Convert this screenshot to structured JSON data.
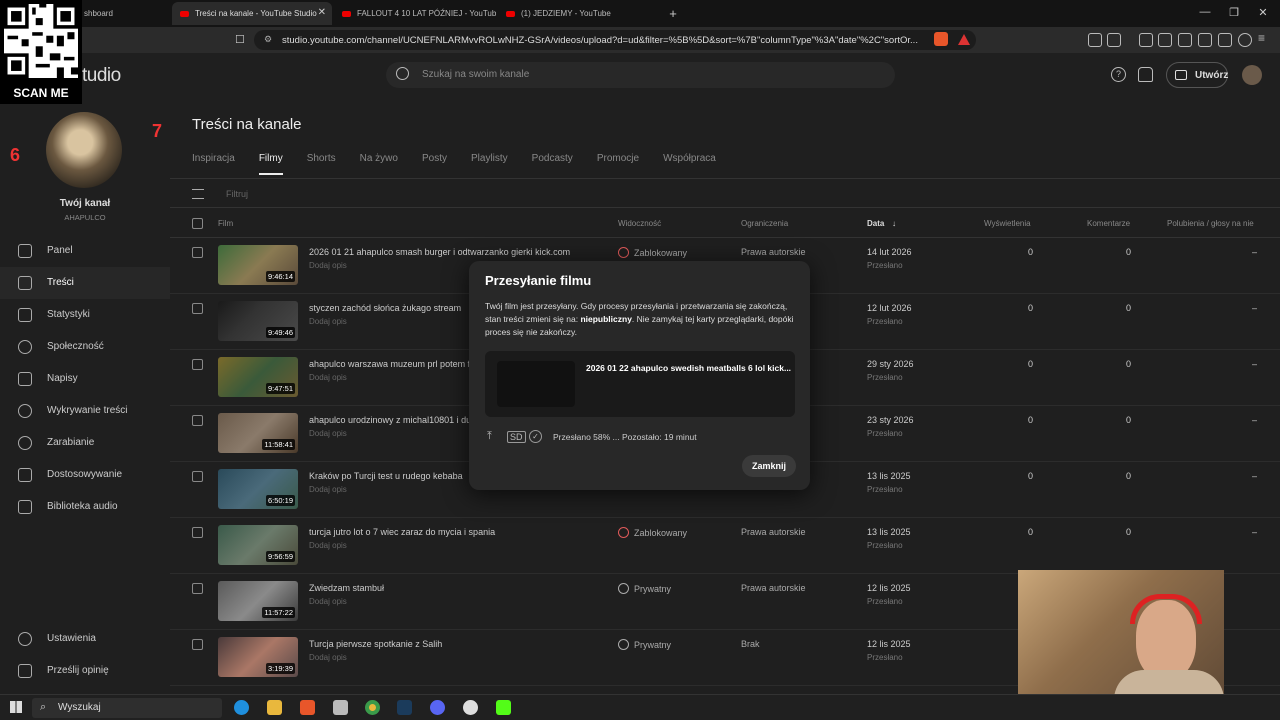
{
  "browser": {
    "tabs": [
      {
        "label": "shboard"
      },
      {
        "label": "Treści na kanale - YouTube Studio"
      },
      {
        "label": "FALLOUT 4 10 LAT PÓŹNIEJ - YouTube"
      },
      {
        "label": "(1) JEDZIEMY - YouTube"
      }
    ],
    "url": "studio.youtube.com/channel/UCNEFNLARMvvROLwNHZ-GSrA/videos/upload?d=ud&filter=%5B%5D&sort=%7B\"columnType\"%3A\"date\"%2C\"sortOr..."
  },
  "studio": {
    "logo_text": "tudio",
    "search_placeholder": "Szukaj na swoim kanale",
    "create_label": "Utwórz"
  },
  "sidebar": {
    "channel_name": "Twój kanał",
    "channel_handle": "AHAPULCO",
    "items": [
      {
        "label": "Panel"
      },
      {
        "label": "Treści"
      },
      {
        "label": "Statystyki"
      },
      {
        "label": "Społeczność"
      },
      {
        "label": "Napisy"
      },
      {
        "label": "Wykrywanie treści"
      },
      {
        "label": "Zarabianie"
      },
      {
        "label": "Dostosowywanie"
      },
      {
        "label": "Biblioteka audio"
      }
    ],
    "bottom_items": [
      {
        "label": "Ustawienia"
      },
      {
        "label": "Prześlij opinię"
      }
    ]
  },
  "main": {
    "title": "Treści na kanale",
    "tabs": [
      {
        "label": "Inspiracja"
      },
      {
        "label": "Filmy"
      },
      {
        "label": "Shorts"
      },
      {
        "label": "Na żywo"
      },
      {
        "label": "Posty"
      },
      {
        "label": "Playlisty"
      },
      {
        "label": "Podcasty"
      },
      {
        "label": "Promocje"
      },
      {
        "label": "Współpraca"
      }
    ],
    "filter_placeholder": "Filtruj",
    "columns": {
      "film": "Film",
      "visibility": "Widoczność",
      "restrictions": "Ograniczenia",
      "date": "Data",
      "views": "Wyświetlenia",
      "comments": "Komentarze",
      "likes": "Polubienia / głosy na nie"
    },
    "rows": [
      {
        "title": "2026 01 21 ahapulco smash burger i odtwarzanko gierki kick.com",
        "desc": "Dodaj opis",
        "duration": "9:46:14",
        "visibility": "Zablokowany",
        "restrictions": "Prawa autorskie",
        "date": "14 lut 2026",
        "status": "Przesłano",
        "views": "0",
        "comments": "0",
        "likes": "–"
      },
      {
        "title": "styczen zachód słońca żukago stream",
        "desc": "Dodaj opis",
        "duration": "9:49:46",
        "visibility": "",
        "restrictions": "",
        "date": "12 lut 2026",
        "status": "Przesłano",
        "views": "0",
        "comments": "0",
        "likes": "–"
      },
      {
        "title": "ahapulco warszawa muzeum prl potem fo",
        "desc": "Dodaj opis",
        "duration": "9:47:51",
        "visibility": "",
        "restrictions": "",
        "date": "29 sty 2026",
        "status": "Przesłano",
        "views": "0",
        "comments": "0",
        "likes": "–"
      },
      {
        "title": "ahapulco urodzinowy z michal10801 i duc",
        "desc": "Dodaj opis",
        "duration": "11:58:41",
        "visibility": "",
        "restrictions": "",
        "date": "23 sty 2026",
        "status": "Przesłano",
        "views": "0",
        "comments": "0",
        "likes": "–"
      },
      {
        "title": "Kraków po Turcji test u rudego kebaba",
        "desc": "Dodaj opis",
        "duration": "6:50:19",
        "visibility": "",
        "restrictions": "",
        "date": "13 lis 2025",
        "status": "Przesłano",
        "views": "0",
        "comments": "0",
        "likes": "–"
      },
      {
        "title": "turcja jutro lot o 7 wiec zaraz do mycia i spania",
        "desc": "Dodaj opis",
        "duration": "9:56:59",
        "visibility": "Zablokowany",
        "restrictions": "Prawa autorskie",
        "date": "13 lis 2025",
        "status": "Przesłano",
        "views": "0",
        "comments": "0",
        "likes": "–"
      },
      {
        "title": "Zwiedzam stambuł",
        "desc": "Dodaj opis",
        "duration": "11:57:22",
        "visibility": "Prywatny",
        "restrictions": "Prawa autorskie",
        "date": "12 lis 2025",
        "status": "Przesłano",
        "views": "",
        "comments": "",
        "likes": ""
      },
      {
        "title": "Turcja pierwsze spotkanie z Salih",
        "desc": "Dodaj opis",
        "duration": "3:19:39",
        "visibility": "Prywatny",
        "restrictions": "Brak",
        "date": "12 lis 2025",
        "status": "Przesłano",
        "views": "",
        "comments": "",
        "likes": ""
      }
    ]
  },
  "modal": {
    "title": "Przesyłanie filmu",
    "text_before": "Twój film jest przesyłany. Gdy procesy przesyłania i przetwarzania się zakończą, stan treści zmieni się na: ",
    "text_bold": "niepubliczny",
    "text_after": ". Nie zamykaj tej karty przeglądarki, dopóki proces się nie zakończy.",
    "video_title": "2026 01 22 ahapulco swedish meatballs 6 lol kick...",
    "progress": "Przesłano 58% ... Pozostało: 19 minut",
    "close_label": "Zamknij"
  },
  "overlay": {
    "scan_label": "SCAN ME"
  },
  "taskbar": {
    "search_label": "Wyszukaj"
  }
}
